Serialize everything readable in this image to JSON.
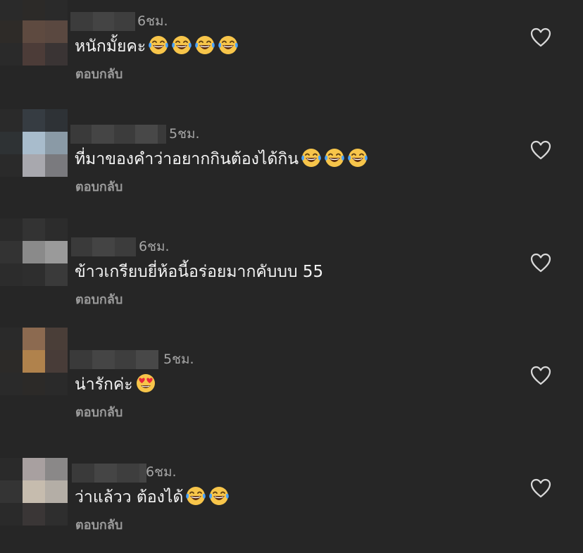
{
  "colors": {
    "background": "#262626",
    "text": "#f5f5f5",
    "muted": "#a6a6a6",
    "reply": "#9a9a9a",
    "heart_outline": "#d9d9d9",
    "emoji_face": "#f7c54a"
  },
  "icons": {
    "like": "heart-outline-icon",
    "laugh": "face-with-tears-of-joy-emoji",
    "love": "smiling-face-with-heart-eyes-emoji"
  },
  "comments": [
    {
      "time": "6ชม.",
      "text": "หนักมั้ยคะ",
      "emoji": [
        "laugh",
        "laugh",
        "laugh",
        "laugh"
      ],
      "reply_label": "ตอบกลับ"
    },
    {
      "time": "5ชม.",
      "text": "ที่มาของคำว่าอยากกินต้องได้กิน",
      "emoji": [
        "laugh",
        "laugh",
        "laugh"
      ],
      "reply_label": "ตอบกลับ"
    },
    {
      "time": "6ชม.",
      "text": "ข้าวเกรียบยี่ห้อนี้อร่อยมากคับบบ 55",
      "emoji": [],
      "reply_label": "ตอบกลับ"
    },
    {
      "time": "5ชม.",
      "text": "น่ารักค่ะ",
      "emoji": [
        "love"
      ],
      "reply_label": "ตอบกลับ"
    },
    {
      "time": "6ชม.",
      "text": "ว่าแล้วว ต้องได้",
      "emoji": [
        "laugh",
        "laugh"
      ],
      "reply_label": "ตอบกลับ"
    }
  ]
}
